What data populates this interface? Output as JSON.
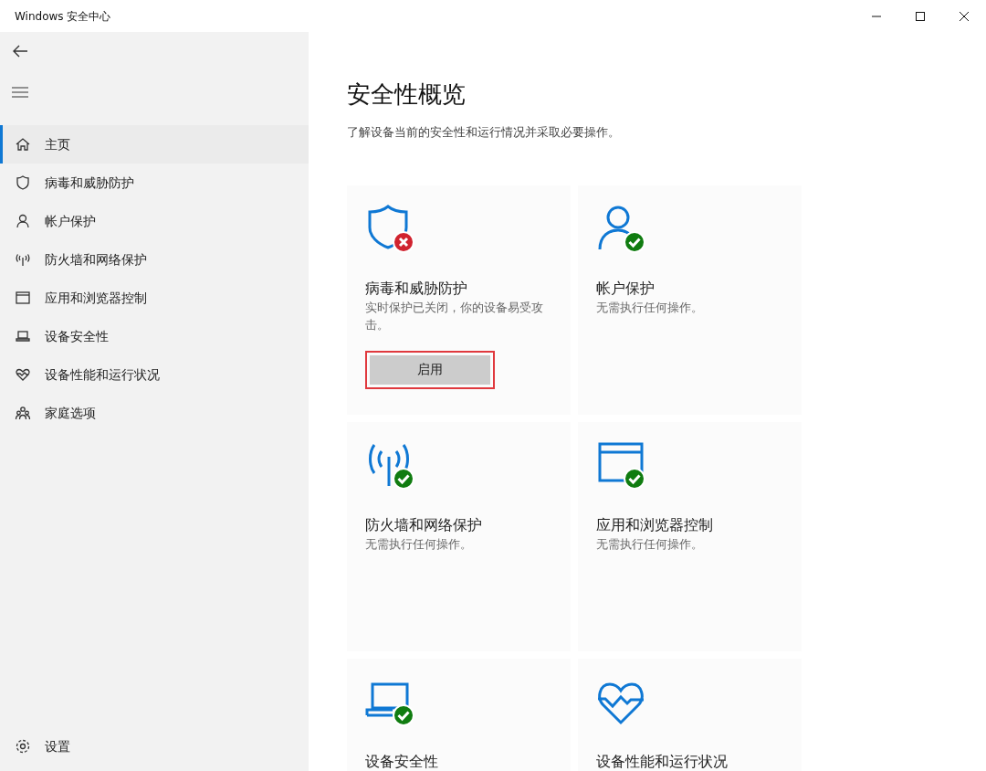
{
  "window": {
    "title": "Windows 安全中心"
  },
  "sidebar": {
    "items": [
      {
        "kind": "home",
        "label": "主页",
        "selected": true
      },
      {
        "kind": "shield",
        "label": "病毒和威胁防护",
        "selected": false
      },
      {
        "kind": "person",
        "label": "帐户保护",
        "selected": false
      },
      {
        "kind": "antenna",
        "label": "防火墙和网络保护",
        "selected": false
      },
      {
        "kind": "window",
        "label": "应用和浏览器控制",
        "selected": false
      },
      {
        "kind": "laptop",
        "label": "设备安全性",
        "selected": false
      },
      {
        "kind": "heart",
        "label": "设备性能和运行状况",
        "selected": false
      },
      {
        "kind": "family",
        "label": "家庭选项",
        "selected": false
      }
    ],
    "settings": {
      "label": "设置"
    }
  },
  "page": {
    "title": "安全性概览",
    "subtitle": "了解设备当前的安全性和运行情况并采取必要操作。"
  },
  "cards": [
    {
      "kind": "shield",
      "ok": false,
      "title": "病毒和威胁防护",
      "description": "实时保护已关闭，你的设备易受攻击。",
      "button": {
        "label": "启用",
        "highlighted": true
      }
    },
    {
      "kind": "person",
      "ok": true,
      "title": "帐户保护",
      "description": "无需执行任何操作。"
    },
    {
      "kind": "antenna",
      "ok": true,
      "title": "防火墙和网络保护",
      "description": "无需执行任何操作。"
    },
    {
      "kind": "window",
      "ok": true,
      "title": "应用和浏览器控制",
      "description": "无需执行任何操作。"
    },
    {
      "kind": "laptop",
      "ok": true,
      "title": "设备安全性"
    },
    {
      "kind": "heart",
      "title": "设备性能和运行状况"
    }
  ]
}
